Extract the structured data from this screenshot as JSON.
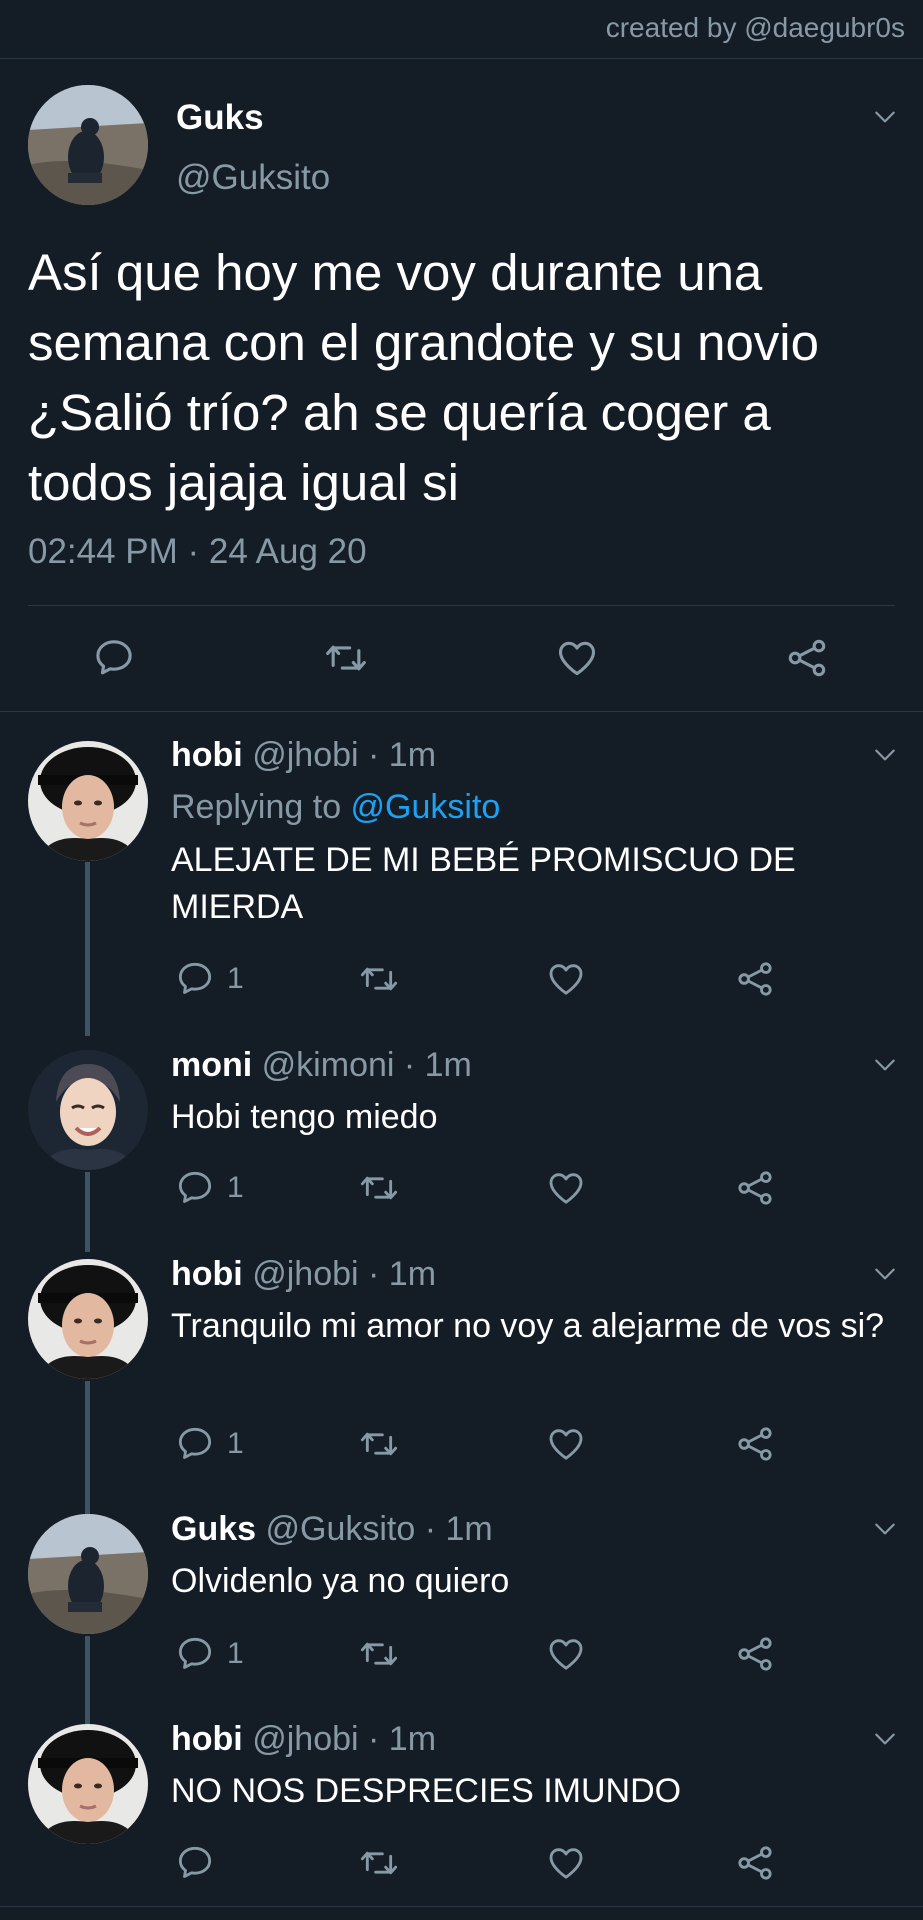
{
  "watermark": "created by @daegubr0s",
  "main_tweet": {
    "name": "Guks",
    "handle": "@Guksito",
    "text": "Así que hoy me voy durante una semana con el grandote y su novio ¿Salió trío? ah se quería coger a todos jajaja igual si",
    "timestamp": "02:44 PM · 24 Aug 20",
    "actions": [
      "reply-icon",
      "retweet-icon",
      "like-icon",
      "share-icon"
    ]
  },
  "replies": [
    {
      "name": "hobi",
      "handle": "@jhobi · 1m",
      "replying_prefix": "Replying to ",
      "replying_to": "@Guksito",
      "text": "ALEJATE DE MI BEBÉ PROMISCUO DE MIERDA",
      "reply_count": "1",
      "avatar": "hobi"
    },
    {
      "name": "moni",
      "handle": "@kimoni · 1m",
      "text": "Hobi tengo miedo",
      "reply_count": "1",
      "avatar": "moni"
    },
    {
      "name": "hobi",
      "handle": "@jhobi · 1m",
      "text": "Tranquilo mi amor no voy a alejarme de vos si?",
      "reply_count": "1",
      "avatar": "hobi"
    },
    {
      "name": "Guks",
      "handle": "@Guksito · 1m",
      "text": "Olvidenlo ya no quiero",
      "reply_count": "1",
      "avatar": "guks"
    },
    {
      "name": "hobi",
      "handle": "@jhobi · 1m",
      "text": "NO NOS DESPRECIES IMUNDO",
      "reply_count": "",
      "avatar": "hobi"
    }
  ],
  "colors": {
    "background": "#141d26",
    "secondary_text": "#8899a6",
    "link": "#1da1f2",
    "divider": "#2a3846",
    "thread_line": "#3d5466"
  }
}
